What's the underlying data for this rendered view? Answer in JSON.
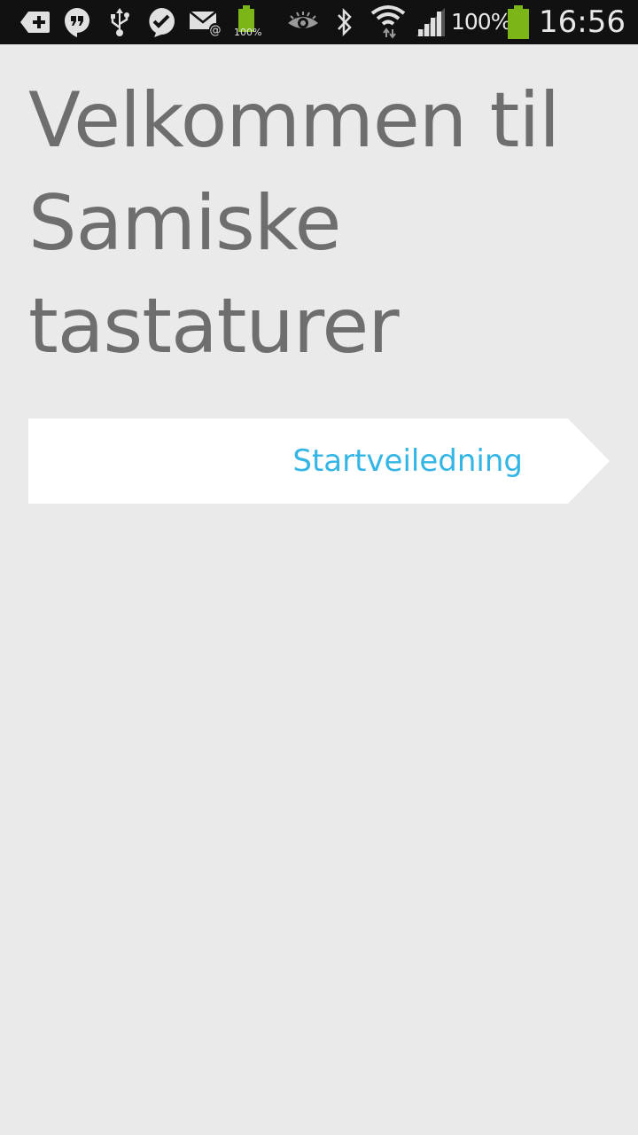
{
  "status_bar": {
    "battery_percent_label": "100%",
    "small_battery_label": "100%",
    "time": "16:56",
    "battery_level": 1.0,
    "icons": [
      "add-notification-icon",
      "hangouts-icon",
      "usb-icon",
      "checkmark-bubble-icon",
      "email-icon",
      "battery-small-icon",
      "eye-icon",
      "bluetooth-icon",
      "wifi-icon",
      "signal-icon",
      "battery-icon"
    ]
  },
  "main": {
    "title": "Velkommen til Samiske tastaturer",
    "start_button_label": "Startveiledning"
  },
  "colors": {
    "background": "#eaeaea",
    "title": "#6e6e6e",
    "accent": "#33b5e5",
    "button_bg": "#ffffff",
    "battery": "#7cb518"
  }
}
